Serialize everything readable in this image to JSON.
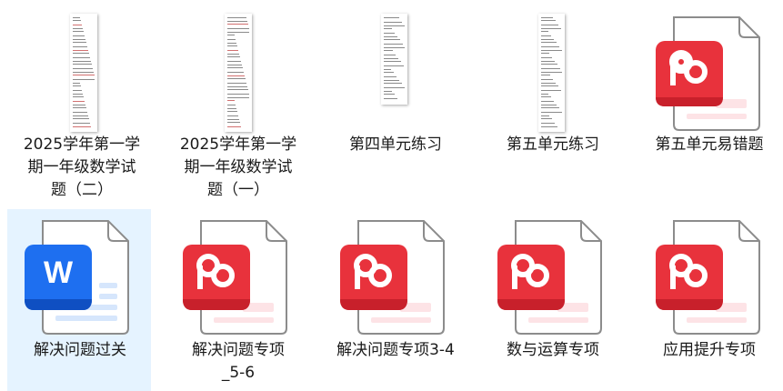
{
  "files": [
    {
      "name": "2025学年第一学\n期一年级数学试\n题（二）",
      "type": "doc-thumbnail",
      "icon": "document-page-icon"
    },
    {
      "name": "2025学年第一学\n期一年级数学试\n题（一）",
      "type": "doc-thumbnail",
      "icon": "document-page-icon"
    },
    {
      "name": "第四单元练习",
      "type": "doc-thumbnail",
      "icon": "document-page-icon"
    },
    {
      "name": "第五单元练习",
      "type": "doc-thumbnail",
      "icon": "document-page-icon"
    },
    {
      "name": "第五单元易错题",
      "type": "wps-pdf",
      "icon": "wps-pdf-icon"
    },
    {
      "name": "解决问题过关",
      "type": "word",
      "icon": "word-icon",
      "selected": true
    },
    {
      "name": "解决问题专项\n_5-6",
      "type": "wps-pdf",
      "icon": "wps-pdf-icon"
    },
    {
      "name": "解决问题专项3-4",
      "type": "wps-pdf",
      "icon": "wps-pdf-icon"
    },
    {
      "name": "数与运算专项",
      "type": "wps-pdf",
      "icon": "wps-pdf-icon"
    },
    {
      "name": "应用提升专项",
      "type": "wps-pdf",
      "icon": "wps-pdf-icon"
    }
  ],
  "colors": {
    "pdf_red": "#e8323c",
    "pdf_red_dark": "#c8202b",
    "word_blue": "#1e6ff0",
    "word_blue_dark": "#0f4fc2",
    "selection": "#e5f3ff"
  }
}
